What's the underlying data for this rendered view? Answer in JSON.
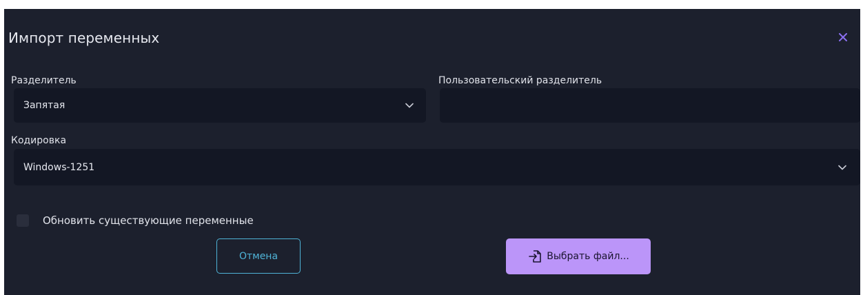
{
  "dialog": {
    "title": "Импорт переменных",
    "close_icon": "close-icon"
  },
  "separator": {
    "label": "Разделитель",
    "value": "Запятая",
    "icon": "chevron-down-icon"
  },
  "custom_separator": {
    "label": "Пользовательский разделитель",
    "value": ""
  },
  "encoding": {
    "label": "Кодировка",
    "value": "Windows-1251",
    "icon": "chevron-down-icon"
  },
  "update_existing": {
    "label": "Обновить существующие переменные",
    "checked": false
  },
  "buttons": {
    "cancel_label": "Отмена",
    "file_label": "Выбрать файл...",
    "file_icon": "file-import-icon"
  },
  "colors": {
    "dialog_bg": "#1c202d",
    "field_bg": "#131724",
    "accent_purple": "#bb95f9",
    "accent_cyan": "#4fb4d8",
    "close_icon": "#8a6ff0"
  }
}
